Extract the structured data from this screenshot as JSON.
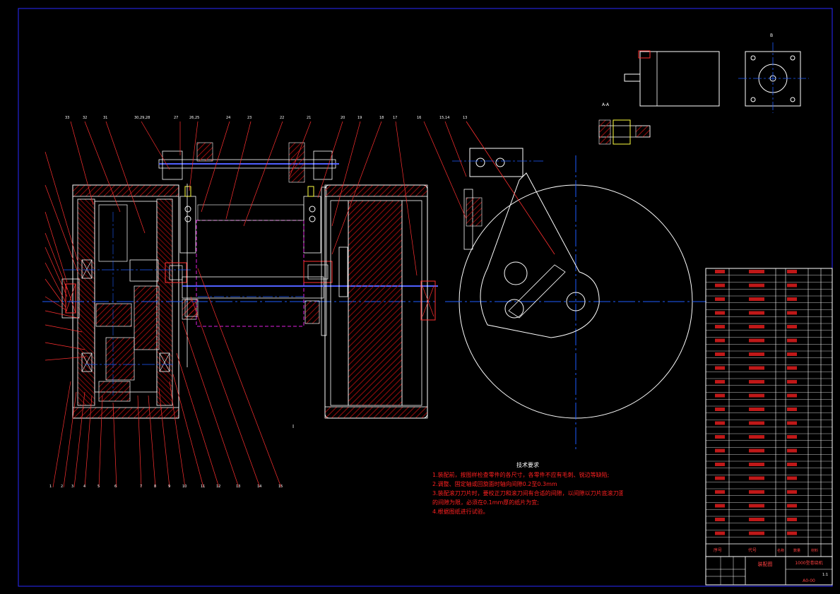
{
  "colors": {
    "background": "#000000",
    "frame": "#2a2aff",
    "outline": "#ffffff",
    "hatch": "#d01010",
    "centerline": "#1e5cff",
    "shaft": "#5060ff",
    "magenta": "#e020e0",
    "yellow": "#ffff40",
    "bearing": "#ff3030"
  },
  "notes": {
    "title": "技术要求",
    "lines": [
      "1.装配前，按图样检查零件的各尺寸，各零件不应有毛刺、锐边等缺陷;",
      "2.调整、固定轴或回旋面时轴向间隙0.2至0.3mm",
      "3.装配滚刀刀片时，要校正刀和滚刀间有合适的间隙，以间隙以刀片底滚刀面",
      "的间隙为限，必须在0.1mm厚的纸片为宜;",
      "4.根据图纸进行试验。"
    ]
  },
  "title_block": {
    "drawing_name": "1000型卷绕机",
    "sheet": "装配图",
    "scale": "1:1",
    "drawing_no": "A0-00"
  },
  "bom_headers": [
    "序号",
    "代号",
    "名称",
    "数量",
    "材料"
  ],
  "view_labels": {
    "section_a": "A-A",
    "section_b": "B",
    "detail": "I"
  },
  "callouts_bottom": [
    "1",
    "2",
    "3",
    "4",
    "5",
    "6",
    "7",
    "8",
    "9",
    "10",
    "11",
    "12",
    "13",
    "14",
    "15"
  ],
  "callouts_top": [
    "33",
    "32",
    "31",
    "30,29,28",
    "27",
    "26,25",
    "24",
    "23",
    "22",
    "21",
    "20",
    "19",
    "18",
    "17",
    "16",
    "15,14",
    "13",
    "12"
  ]
}
